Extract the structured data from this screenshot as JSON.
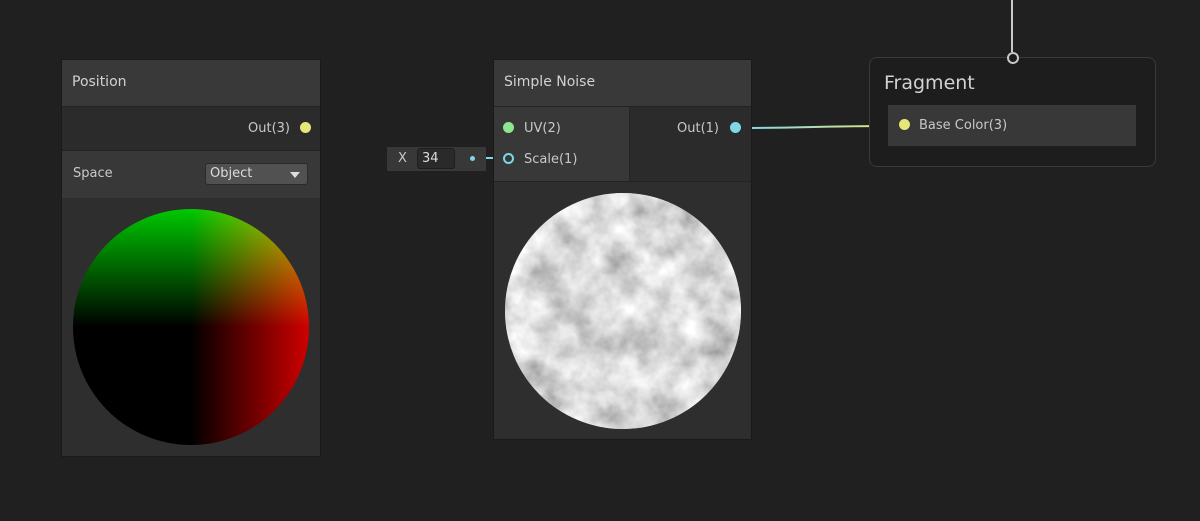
{
  "position_node": {
    "title": "Position",
    "output": "Out(3)",
    "space_label": "Space",
    "space_value": "Object"
  },
  "noise_node": {
    "title": "Simple Noise",
    "inputs": [
      "UV(2)",
      "Scale(1)"
    ],
    "output": "Out(1)",
    "scale_field": {
      "axis": "X",
      "value": "34"
    }
  },
  "fragment_node": {
    "title": "Fragment",
    "inputs": [
      "Base Color(3)"
    ]
  },
  "colors": {
    "vector3": "#e6e67a",
    "vector2": "#8ee68e",
    "float": "#7ed6e6"
  }
}
